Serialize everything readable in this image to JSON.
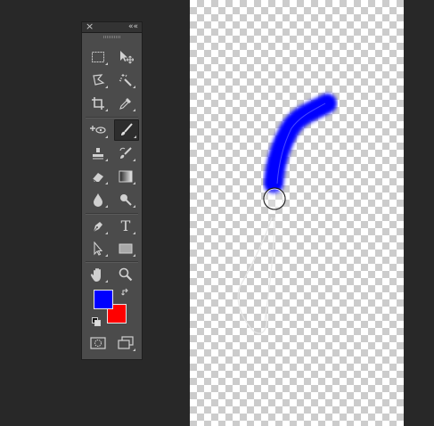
{
  "panel": {
    "close_glyph": "×",
    "collapse_glyph": "««",
    "tools": [
      {
        "name": "marquee-tool",
        "selected": false
      },
      {
        "name": "move-tool",
        "selected": false
      },
      {
        "name": "lasso-tool",
        "selected": false
      },
      {
        "name": "magic-wand-tool",
        "selected": false
      },
      {
        "name": "crop-tool",
        "selected": false
      },
      {
        "name": "eyedropper-tool",
        "selected": false
      },
      {
        "name": "spot-healing-tool",
        "selected": false
      },
      {
        "name": "brush-tool",
        "selected": true
      },
      {
        "name": "clone-stamp-tool",
        "selected": false
      },
      {
        "name": "history-brush-tool",
        "selected": false
      },
      {
        "name": "eraser-tool",
        "selected": false
      },
      {
        "name": "gradient-tool",
        "selected": false
      },
      {
        "name": "blur-tool",
        "selected": false
      },
      {
        "name": "dodge-tool",
        "selected": false
      },
      {
        "name": "pen-tool",
        "selected": false
      },
      {
        "name": "type-tool",
        "selected": false
      },
      {
        "name": "path-selection-tool",
        "selected": false
      },
      {
        "name": "rectangle-tool",
        "selected": false
      },
      {
        "name": "hand-tool",
        "selected": false
      },
      {
        "name": "zoom-tool",
        "selected": false
      }
    ],
    "type_tool_glyph": "T",
    "foreground_color": "#0000ff",
    "background_color": "#ff0000"
  },
  "canvas": {
    "brush_color": "#0000ff",
    "checker_light": "#ffffff",
    "checker_dark": "#cccccc"
  }
}
